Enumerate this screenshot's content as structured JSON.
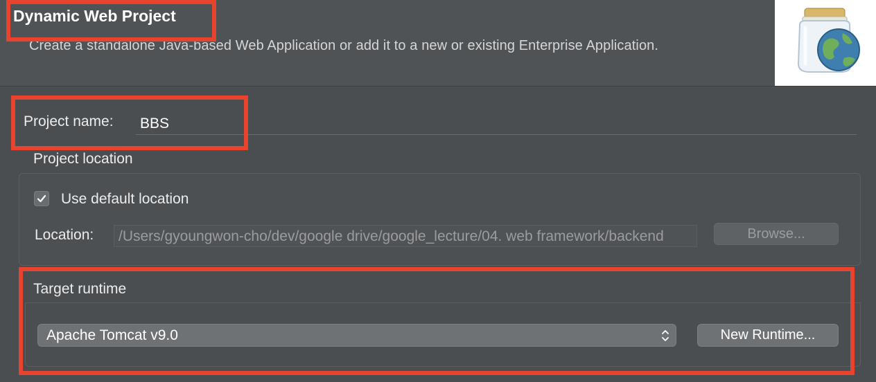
{
  "wizard": {
    "title": "Dynamic Web Project",
    "description": "Create a standalone Java-based Web Application or add it to a new or existing Enterprise Application."
  },
  "project_name": {
    "label": "Project name:",
    "value": "BBS"
  },
  "project_location": {
    "group_label": "Project location",
    "use_default_label": "Use default location",
    "use_default_checked": true,
    "location_label": "Location:",
    "location_value": "/Users/gyoungwon-cho/dev/google drive/google_lecture/04. web framework/backend",
    "browse_label": "Browse..."
  },
  "target_runtime": {
    "group_label": "Target runtime",
    "selected": "Apache Tomcat v9.0",
    "new_runtime_label": "New Runtime..."
  },
  "colors": {
    "highlight": "#e8432d",
    "background": "#4b4e51"
  },
  "icons": [
    "jar-web-icon",
    "checkmark-icon",
    "updown-arrows-icon"
  ]
}
